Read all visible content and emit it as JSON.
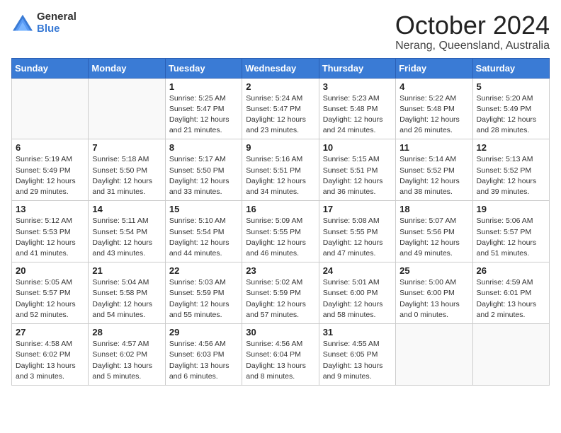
{
  "logo": {
    "general": "General",
    "blue": "Blue"
  },
  "title": "October 2024",
  "location": "Nerang, Queensland, Australia",
  "days_of_week": [
    "Sunday",
    "Monday",
    "Tuesday",
    "Wednesday",
    "Thursday",
    "Friday",
    "Saturday"
  ],
  "weeks": [
    [
      {
        "day": "",
        "info": ""
      },
      {
        "day": "",
        "info": ""
      },
      {
        "day": "1",
        "info": "Sunrise: 5:25 AM\nSunset: 5:47 PM\nDaylight: 12 hours and 21 minutes."
      },
      {
        "day": "2",
        "info": "Sunrise: 5:24 AM\nSunset: 5:47 PM\nDaylight: 12 hours and 23 minutes."
      },
      {
        "day": "3",
        "info": "Sunrise: 5:23 AM\nSunset: 5:48 PM\nDaylight: 12 hours and 24 minutes."
      },
      {
        "day": "4",
        "info": "Sunrise: 5:22 AM\nSunset: 5:48 PM\nDaylight: 12 hours and 26 minutes."
      },
      {
        "day": "5",
        "info": "Sunrise: 5:20 AM\nSunset: 5:49 PM\nDaylight: 12 hours and 28 minutes."
      }
    ],
    [
      {
        "day": "6",
        "info": "Sunrise: 5:19 AM\nSunset: 5:49 PM\nDaylight: 12 hours and 29 minutes."
      },
      {
        "day": "7",
        "info": "Sunrise: 5:18 AM\nSunset: 5:50 PM\nDaylight: 12 hours and 31 minutes."
      },
      {
        "day": "8",
        "info": "Sunrise: 5:17 AM\nSunset: 5:50 PM\nDaylight: 12 hours and 33 minutes."
      },
      {
        "day": "9",
        "info": "Sunrise: 5:16 AM\nSunset: 5:51 PM\nDaylight: 12 hours and 34 minutes."
      },
      {
        "day": "10",
        "info": "Sunrise: 5:15 AM\nSunset: 5:51 PM\nDaylight: 12 hours and 36 minutes."
      },
      {
        "day": "11",
        "info": "Sunrise: 5:14 AM\nSunset: 5:52 PM\nDaylight: 12 hours and 38 minutes."
      },
      {
        "day": "12",
        "info": "Sunrise: 5:13 AM\nSunset: 5:52 PM\nDaylight: 12 hours and 39 minutes."
      }
    ],
    [
      {
        "day": "13",
        "info": "Sunrise: 5:12 AM\nSunset: 5:53 PM\nDaylight: 12 hours and 41 minutes."
      },
      {
        "day": "14",
        "info": "Sunrise: 5:11 AM\nSunset: 5:54 PM\nDaylight: 12 hours and 43 minutes."
      },
      {
        "day": "15",
        "info": "Sunrise: 5:10 AM\nSunset: 5:54 PM\nDaylight: 12 hours and 44 minutes."
      },
      {
        "day": "16",
        "info": "Sunrise: 5:09 AM\nSunset: 5:55 PM\nDaylight: 12 hours and 46 minutes."
      },
      {
        "day": "17",
        "info": "Sunrise: 5:08 AM\nSunset: 5:55 PM\nDaylight: 12 hours and 47 minutes."
      },
      {
        "day": "18",
        "info": "Sunrise: 5:07 AM\nSunset: 5:56 PM\nDaylight: 12 hours and 49 minutes."
      },
      {
        "day": "19",
        "info": "Sunrise: 5:06 AM\nSunset: 5:57 PM\nDaylight: 12 hours and 51 minutes."
      }
    ],
    [
      {
        "day": "20",
        "info": "Sunrise: 5:05 AM\nSunset: 5:57 PM\nDaylight: 12 hours and 52 minutes."
      },
      {
        "day": "21",
        "info": "Sunrise: 5:04 AM\nSunset: 5:58 PM\nDaylight: 12 hours and 54 minutes."
      },
      {
        "day": "22",
        "info": "Sunrise: 5:03 AM\nSunset: 5:59 PM\nDaylight: 12 hours and 55 minutes."
      },
      {
        "day": "23",
        "info": "Sunrise: 5:02 AM\nSunset: 5:59 PM\nDaylight: 12 hours and 57 minutes."
      },
      {
        "day": "24",
        "info": "Sunrise: 5:01 AM\nSunset: 6:00 PM\nDaylight: 12 hours and 58 minutes."
      },
      {
        "day": "25",
        "info": "Sunrise: 5:00 AM\nSunset: 6:00 PM\nDaylight: 13 hours and 0 minutes."
      },
      {
        "day": "26",
        "info": "Sunrise: 4:59 AM\nSunset: 6:01 PM\nDaylight: 13 hours and 2 minutes."
      }
    ],
    [
      {
        "day": "27",
        "info": "Sunrise: 4:58 AM\nSunset: 6:02 PM\nDaylight: 13 hours and 3 minutes."
      },
      {
        "day": "28",
        "info": "Sunrise: 4:57 AM\nSunset: 6:02 PM\nDaylight: 13 hours and 5 minutes."
      },
      {
        "day": "29",
        "info": "Sunrise: 4:56 AM\nSunset: 6:03 PM\nDaylight: 13 hours and 6 minutes."
      },
      {
        "day": "30",
        "info": "Sunrise: 4:56 AM\nSunset: 6:04 PM\nDaylight: 13 hours and 8 minutes."
      },
      {
        "day": "31",
        "info": "Sunrise: 4:55 AM\nSunset: 6:05 PM\nDaylight: 13 hours and 9 minutes."
      },
      {
        "day": "",
        "info": ""
      },
      {
        "day": "",
        "info": ""
      }
    ]
  ]
}
